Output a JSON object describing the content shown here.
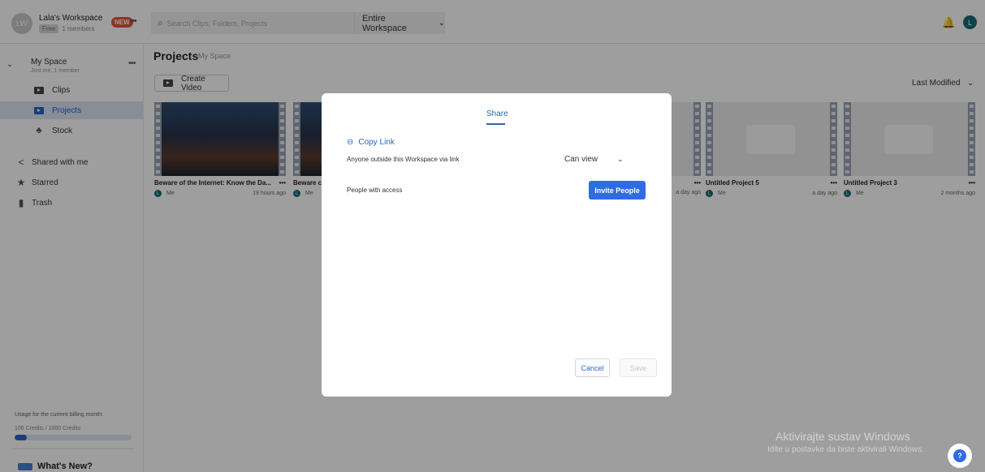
{
  "workspace": {
    "avatar_initials": "LW",
    "name": "Lala's Workspace",
    "plan": "Free",
    "members": "1 members",
    "new_badge": "NEW",
    "more_icon": "ellipsis-icon"
  },
  "search": {
    "placeholder": "Search Clips, Folders, Projects",
    "scope": "Entire Workspace"
  },
  "header": {
    "user_initial": "L",
    "bell_icon": "bell-icon"
  },
  "sidebar": {
    "my_space": {
      "title": "My Space",
      "subtitle": "Just me, 1 member"
    },
    "items": [
      {
        "label": "Clips",
        "icon": "film-icon",
        "active": false
      },
      {
        "label": "Projects",
        "icon": "film-icon",
        "active": true
      },
      {
        "label": "Stock",
        "icon": "stock-icon",
        "active": false
      }
    ],
    "links": [
      {
        "label": "Shared with me",
        "icon": "share-icon"
      },
      {
        "label": "Starred",
        "icon": "star-icon"
      },
      {
        "label": "Trash",
        "icon": "trash-icon"
      }
    ],
    "usage_label": "Usage for the current billing month:",
    "credits": "106 Credits / 1000 Credits",
    "credits_used_fraction": 0.106,
    "whats_new": "What's New?"
  },
  "main": {
    "title": "Projects",
    "subtitle": "My Space",
    "create_label": "Create Video",
    "sort_label": "Last Modified",
    "cards": [
      {
        "title": "Beware of the Internet: Know the Da...",
        "owner": "Me",
        "time": "19 hours ago"
      },
      {
        "title": "Beware c",
        "owner": "Me",
        "time": ""
      },
      {
        "title": "",
        "owner": "",
        "time": "a day ago"
      },
      {
        "title": "Untitled Project 5",
        "owner": "Me",
        "time": "a day ago"
      },
      {
        "title": "Untitled Project 3",
        "owner": "Me",
        "time": "2 months ago"
      }
    ]
  },
  "modal": {
    "tab": "Share",
    "copy_link": "Copy Link",
    "link_description": "Anyone outside this Workspace via link",
    "permission": "Can view",
    "access_label": "People with access",
    "invite_label": "Invite People",
    "cancel_label": "Cancel",
    "save_label": "Save"
  },
  "watermark": {
    "line1": "Aktivirajte sustav Windows",
    "line2": "Idite u postavke da biste aktivirali Windows."
  },
  "colors": {
    "accent": "#2f6be4",
    "active_bg": "#dde4f3",
    "new_badge": "#e8553a",
    "avatar": "#126d78"
  }
}
